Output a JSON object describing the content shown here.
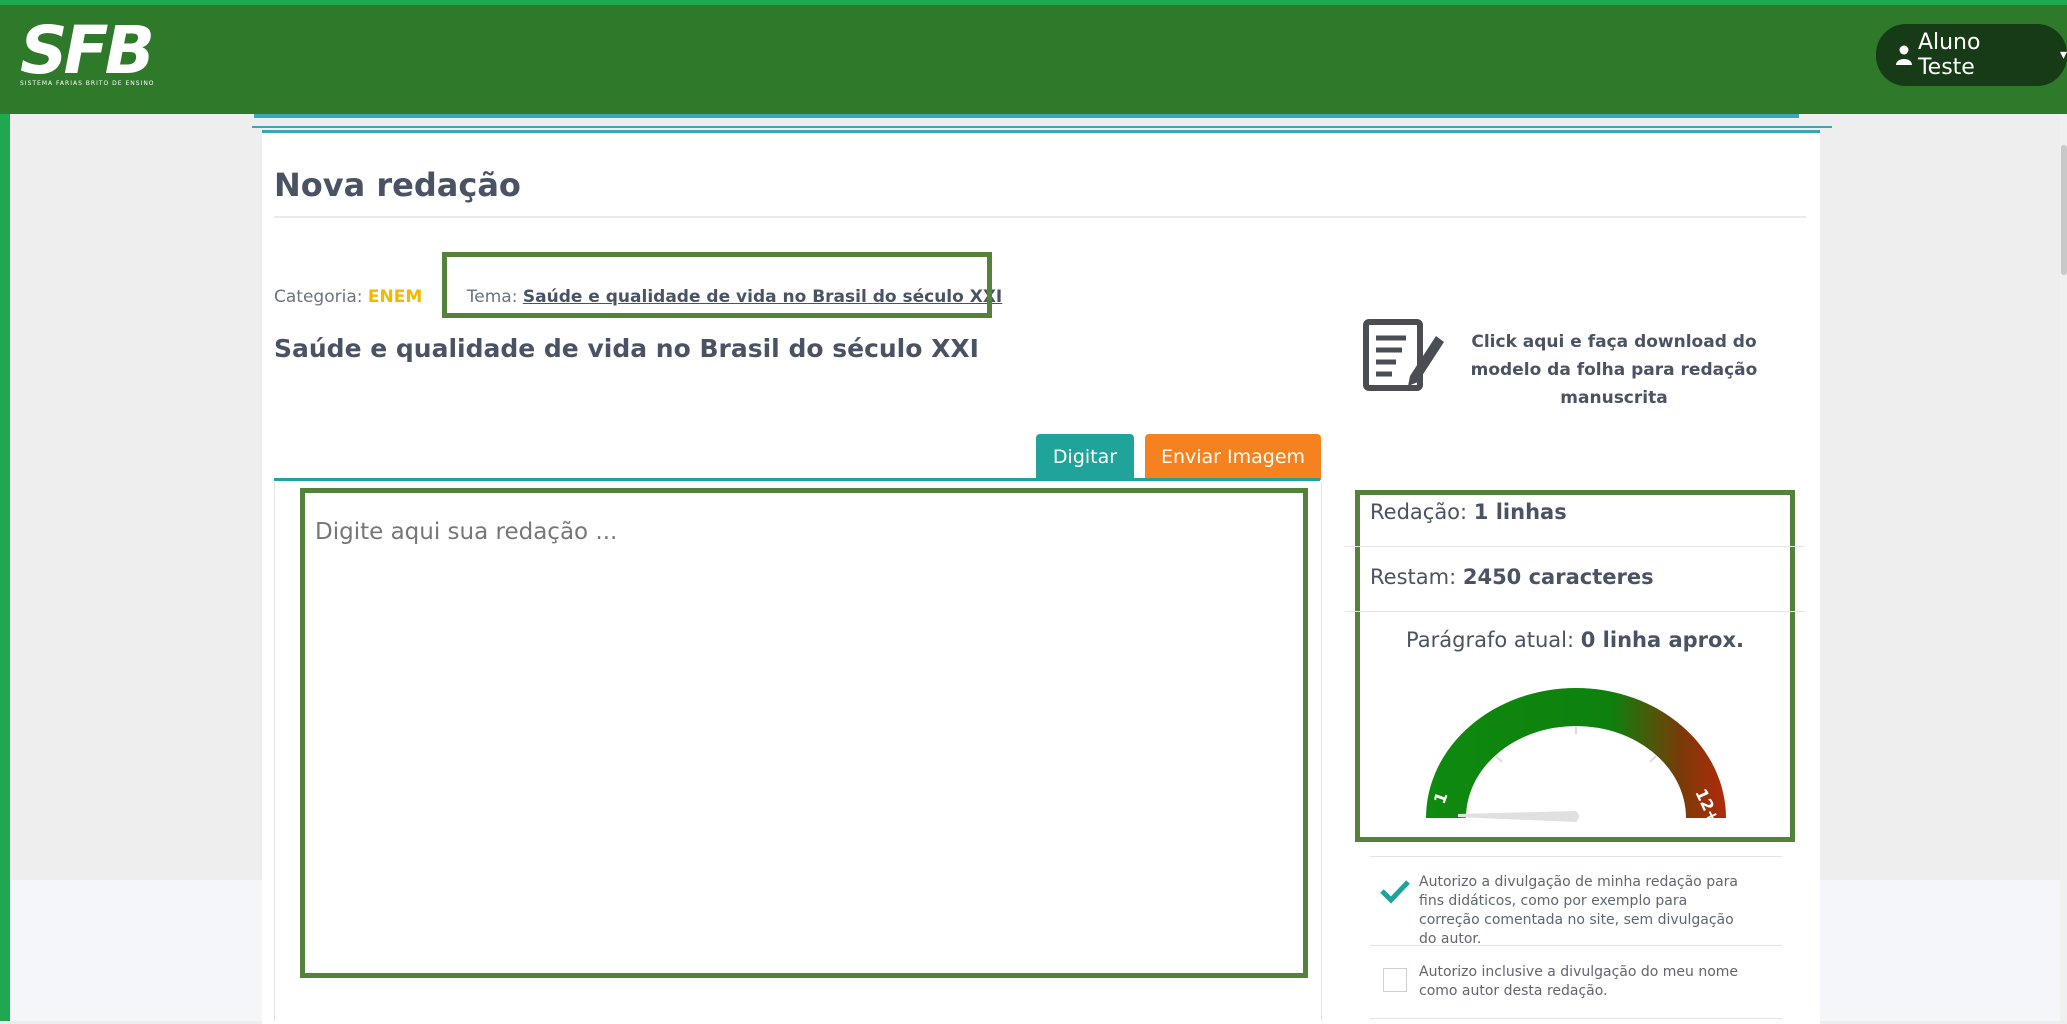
{
  "app": {
    "logo_text": "SFB",
    "logo_subtitle": "SISTEMA FARIAS BRITO DE ENSINO"
  },
  "header": {
    "user_name": "Aluno Teste",
    "user_icon": "user-icon",
    "caret_icon": "caret-down-icon"
  },
  "page": {
    "title": "Nova redação",
    "category_label": "Categoria:",
    "category_value": "ENEM",
    "separator": "|",
    "tema_label": "Tema:",
    "tema_value": "Saúde e qualidade de vida no Brasil do século XXI",
    "essay_heading": "Saúde e qualidade de vida no Brasil do século XXI",
    "download_text": "Click aqui e faça download do modelo da folha para redação manuscrita",
    "download_icon": "document-edit-icon"
  },
  "tabs": [
    {
      "label": "Digitar",
      "color": "#20a39a",
      "active": true
    },
    {
      "label": "Enviar Imagem",
      "color": "#f5821f",
      "active": false
    }
  ],
  "editor": {
    "placeholder": "Digite aqui sua redação ...",
    "value": ""
  },
  "stats": {
    "lines_label": "Redação:",
    "lines_value": "1 linhas",
    "remaining_label": "Restam:",
    "remaining_value": "2450 caracteres",
    "paragraph_label": "Parágrafo atual:",
    "paragraph_value": "0 linha aprox."
  },
  "gauge": {
    "min_label": "1",
    "max_label": "12+",
    "value": 0,
    "colors": {
      "low": "#0e8a0e",
      "high": "#b22a0a",
      "needle": "#e0e0de"
    }
  },
  "consents": [
    {
      "text": "Autorizo a divulgação de minha redação para fins didáticos, como por exemplo para correção comentada no site, sem divulgação do autor.",
      "checked": true
    },
    {
      "text": "Autorizo inclusive a divulgação do meu nome como autor desta redação.",
      "checked": false
    }
  ],
  "colors": {
    "header_bg": "#2f7a2a",
    "accent_teal": "#20a39a",
    "highlight_border": "#53833a",
    "enem_yellow": "#f2b800"
  }
}
